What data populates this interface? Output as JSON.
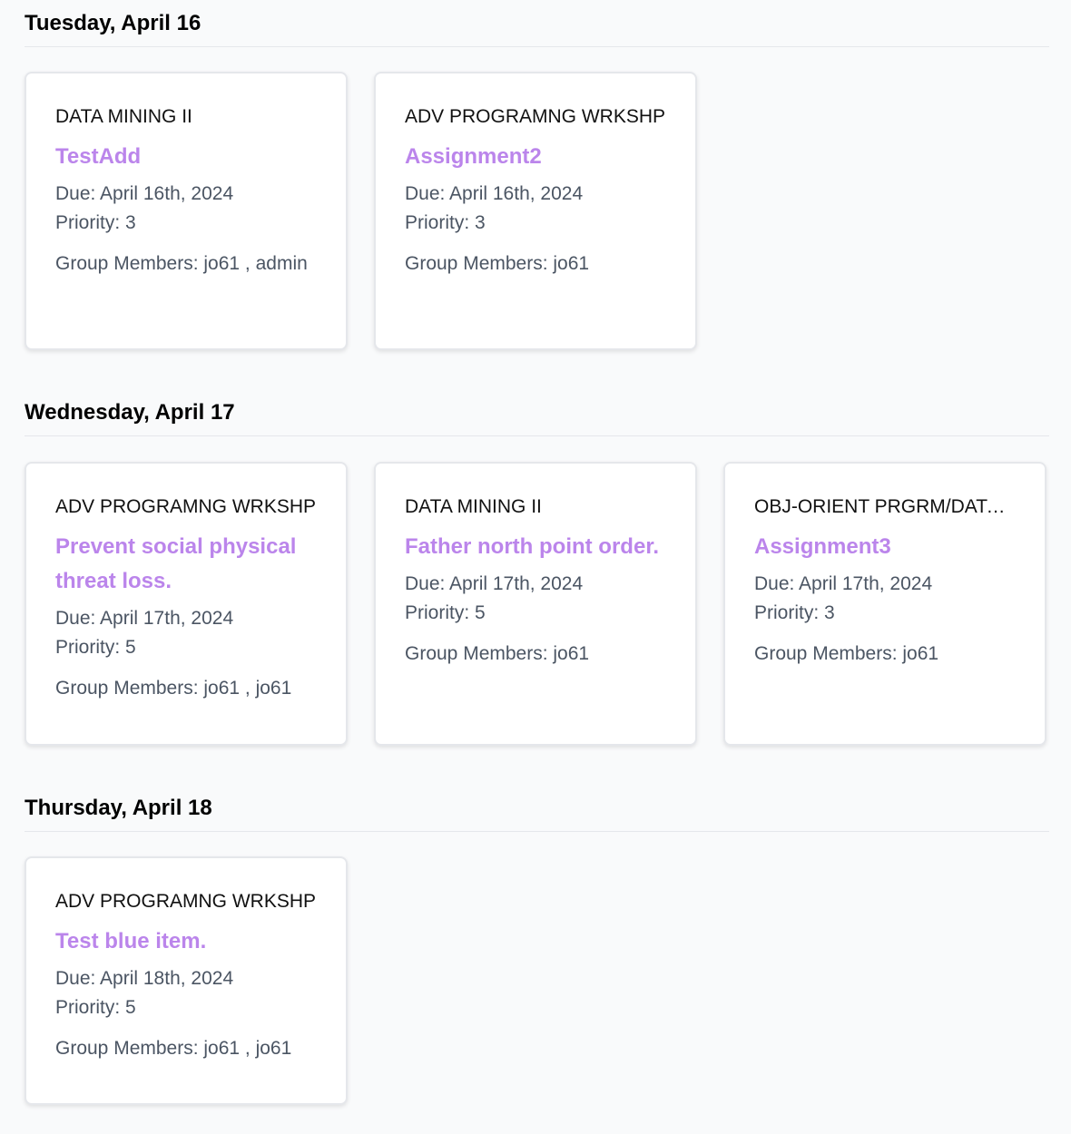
{
  "days": [
    {
      "heading": "Tuesday, April 16",
      "cards": [
        {
          "course": "DATA MINING II",
          "title": "TestAdd",
          "due": "Due: April 16th, 2024",
          "priority": "Priority: 3",
          "members": "Group Members: jo61 , admin"
        },
        {
          "course": "ADV PROGRAMNG WRKSHP",
          "title": "Assignment2",
          "due": "Due: April 16th, 2024",
          "priority": "Priority: 3",
          "members": "Group Members: jo61"
        }
      ]
    },
    {
      "heading": "Wednesday, April 17",
      "cards": [
        {
          "course": "ADV PROGRAMNG WRKSHP",
          "title": "Prevent social physical threat loss.",
          "due": "Due: April 17th, 2024",
          "priority": "Priority: 5",
          "members": "Group Members: jo61 , jo61"
        },
        {
          "course": "DATA MINING II",
          "title": "Father north point order.",
          "due": "Due: April 17th, 2024",
          "priority": "Priority: 5",
          "members": "Group Members: jo61"
        },
        {
          "course": "OBJ-ORIENT PRGRM/DATA STRUCT",
          "title": "Assignment3",
          "due": "Due: April 17th, 2024",
          "priority": "Priority: 3",
          "members": "Group Members: jo61"
        }
      ]
    },
    {
      "heading": "Thursday, April 18",
      "cards": [
        {
          "course": "ADV PROGRAMNG WRKSHP",
          "title": "Test blue item.",
          "due": "Due: April 18th, 2024",
          "priority": "Priority: 5",
          "members": "Group Members: jo61 , jo61"
        }
      ]
    }
  ]
}
